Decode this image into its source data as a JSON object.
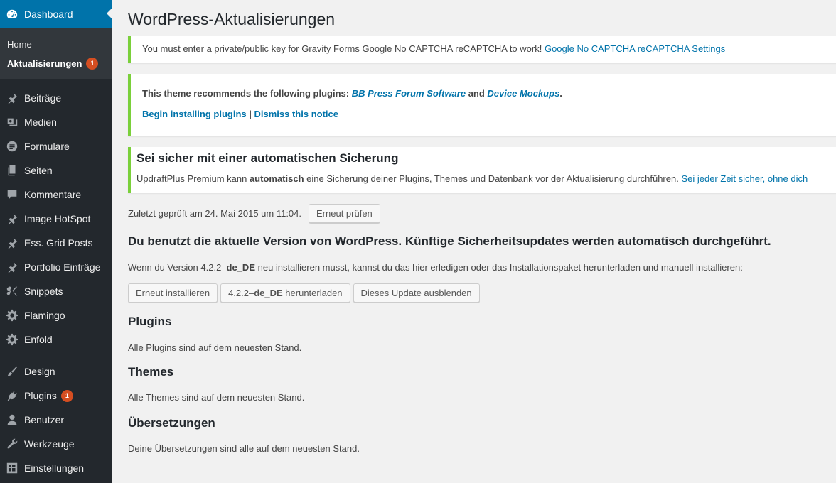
{
  "sidebar": {
    "dashboard": "Dashboard",
    "submenu": [
      {
        "label": "Home"
      },
      {
        "label": "Aktualisierungen",
        "badge": "1"
      }
    ],
    "items": [
      {
        "label": "Beiträge",
        "icon": "pin-icon"
      },
      {
        "label": "Medien",
        "icon": "media-icon"
      },
      {
        "label": "Formulare",
        "icon": "forms-icon"
      },
      {
        "label": "Seiten",
        "icon": "pages-icon"
      },
      {
        "label": "Kommentare",
        "icon": "comments-icon"
      },
      {
        "label": "Image HotSpot",
        "icon": "pin-icon"
      },
      {
        "label": "Ess. Grid Posts",
        "icon": "pin-icon"
      },
      {
        "label": "Portfolio Einträge",
        "icon": "pin-icon"
      },
      {
        "label": "Snippets",
        "icon": "scissors-icon"
      },
      {
        "label": "Flamingo",
        "icon": "gear-icon"
      },
      {
        "label": "Enfold",
        "icon": "gear-icon"
      },
      {
        "label": "Design",
        "icon": "brush-icon"
      },
      {
        "label": "Plugins",
        "icon": "plugin-icon",
        "badge": "1"
      },
      {
        "label": "Benutzer",
        "icon": "user-icon"
      },
      {
        "label": "Werkzeuge",
        "icon": "wrench-icon"
      },
      {
        "label": "Einstellungen",
        "icon": "settings-icon"
      }
    ]
  },
  "page": {
    "title": "WordPress-Aktualisierungen"
  },
  "notice1": {
    "text": "You must enter a private/public key for Gravity Forms Google No CAPTCHA reCAPTCHA to work! ",
    "link": "Google No CAPTCHA reCAPTCHA Settings"
  },
  "notice2": {
    "prefix": "This theme recommends the following plugins: ",
    "plugin1": "BB Press Forum Software",
    "and": " and ",
    "plugin2": "Device Mockups",
    "suffix": ".",
    "install_link": "Begin installing plugins",
    "sep": " | ",
    "dismiss_link": "Dismiss this notice"
  },
  "notice3": {
    "heading": "Sei sicher mit einer automatischen Sicherung",
    "text_a": "UpdraftPlus Premium kann ",
    "text_bold": "automatisch",
    "text_b": " eine Sicherung deiner Plugins, Themes und Datenbank vor der Aktualisierung durchführen. ",
    "link": "Sei jeder Zeit sicher, ohne dich"
  },
  "lastcheck": {
    "text": "Zuletzt geprüft am 24. Mai 2015 um 11:04.",
    "button": "Erneut prüfen"
  },
  "wordpress": {
    "heading": "Du benutzt die aktuelle Version von WordPress. Künftige Sicherheitsupdates werden automatisch durchgeführt.",
    "desc_a": "Wenn du Version 4.2.2–",
    "desc_bold": "de_DE",
    "desc_b": " neu installieren musst, kannst du das hier erledigen oder das Installationspaket herunterladen und manuell installieren:",
    "btn_reinstall": "Erneut installieren",
    "btn_download_a": "4.2.2–",
    "btn_download_bold": "de_DE",
    "btn_download_b": " herunterladen",
    "btn_hide": "Dieses Update ausblenden"
  },
  "plugins": {
    "heading": "Plugins",
    "text": "Alle Plugins sind auf dem neuesten Stand."
  },
  "themes": {
    "heading": "Themes",
    "text": "Alle Themes sind auf dem neuesten Stand."
  },
  "translations": {
    "heading": "Übersetzungen",
    "text": "Deine Übersetzungen sind alle auf dem neuesten Stand."
  }
}
